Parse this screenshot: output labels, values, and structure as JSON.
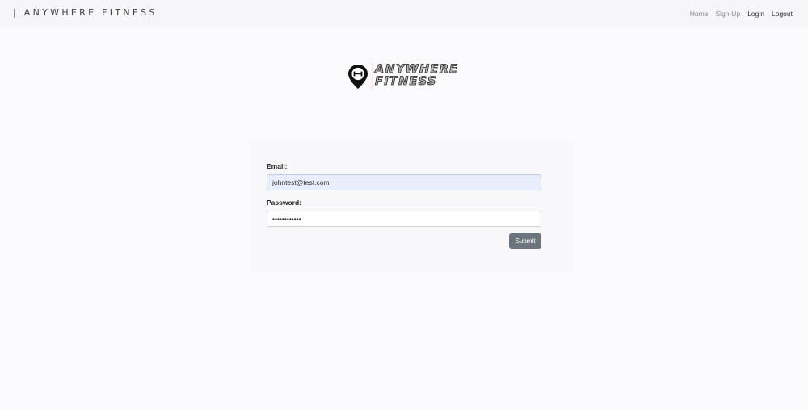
{
  "nav": {
    "brand": "| ANYWHERE FITNESS",
    "links": [
      "Home",
      "Sign-Up",
      "Login",
      "Logout"
    ]
  },
  "logo": {
    "line1": "ANYWHERE",
    "line2": "FITNESS",
    "icon": "map-pin-dumbbell-icon"
  },
  "form": {
    "email_label": "Email:",
    "email_value": "johntest@test.com",
    "password_label": "Password:",
    "password_value": "••••••••••••",
    "submit_label": "Submit"
  },
  "colors": {
    "accent_red": "#c0282d",
    "submit_bg": "#6c757d",
    "email_autofill_bg": "#e8eefb"
  }
}
